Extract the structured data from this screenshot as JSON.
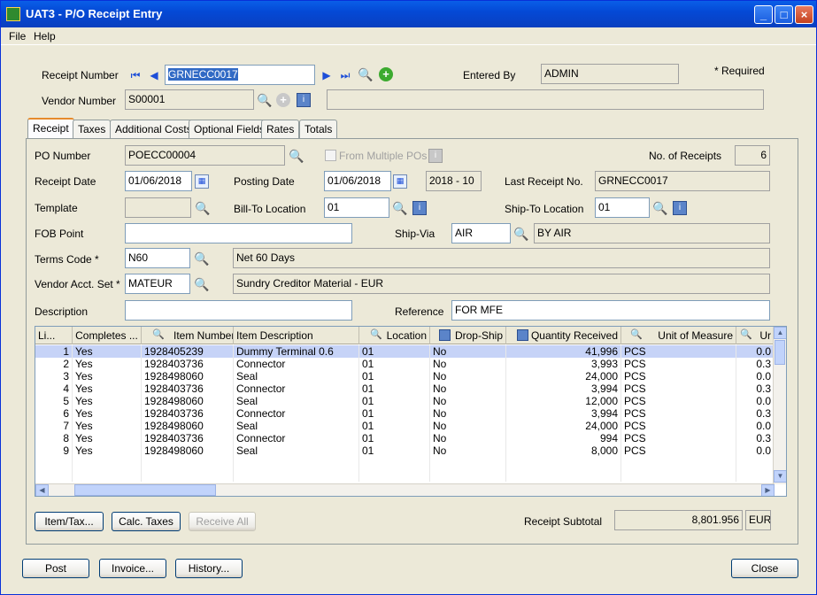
{
  "window": {
    "title": "UAT3 - P/O Receipt Entry"
  },
  "menu": {
    "file": "File",
    "help": "Help"
  },
  "header": {
    "receipt_number_label": "Receipt Number",
    "receipt_number": "GRNECC0017",
    "entered_by_label": "Entered By",
    "entered_by": "ADMIN",
    "required_note": "*  Required",
    "vendor_number_label": "Vendor Number",
    "vendor_number": "S00001",
    "vendor_name": ""
  },
  "tabs": [
    "Receipt",
    "Taxes",
    "Additional Costs",
    "Optional Fields",
    "Rates",
    "Totals"
  ],
  "form": {
    "po_number_label": "PO Number",
    "po_number": "POECC00004",
    "from_multiple_pos": "From Multiple POs",
    "no_of_receipts_label": "No. of Receipts",
    "no_of_receipts": "6",
    "receipt_date_label": "Receipt Date",
    "receipt_date": "01/06/2018",
    "posting_date_label": "Posting Date",
    "posting_date": "01/06/2018",
    "period": "2018 - 10",
    "last_receipt_label": "Last Receipt No.",
    "last_receipt": "GRNECC0017",
    "template_label": "Template",
    "template": "",
    "bill_to_label": "Bill-To Location",
    "bill_to": "01",
    "ship_to_label": "Ship-To Location",
    "ship_to": "01",
    "fob_label": "FOB Point",
    "fob": "",
    "ship_via_label": "Ship-Via",
    "ship_via": "AIR",
    "ship_via_desc": "BY AIR",
    "terms_label": "Terms Code *",
    "terms": "N60",
    "terms_desc": "Net 60 Days",
    "vendor_acct_label": "Vendor Acct. Set *",
    "vendor_acct": "MATEUR",
    "vendor_acct_desc": "Sundry Creditor Material - EUR",
    "description_label": "Description",
    "description": "",
    "reference_label": "Reference",
    "reference": "FOR MFE"
  },
  "grid": {
    "columns": [
      "Li...",
      "Completes ...",
      "Item Number",
      "Item Description",
      "Location",
      "Drop-Ship",
      "Quantity Received",
      "Unit of Measure",
      "Ur"
    ],
    "rows": [
      [
        "1",
        "Yes",
        "1928405239",
        "Dummy Terminal 0.6",
        "01",
        "No",
        "41,996",
        "PCS",
        "0.0"
      ],
      [
        "2",
        "Yes",
        "1928403736",
        "Connector",
        "01",
        "No",
        "3,993",
        "PCS",
        "0.3"
      ],
      [
        "3",
        "Yes",
        "1928498060",
        "Seal",
        "01",
        "No",
        "24,000",
        "PCS",
        "0.0"
      ],
      [
        "4",
        "Yes",
        "1928403736",
        "Connector",
        "01",
        "No",
        "3,994",
        "PCS",
        "0.3"
      ],
      [
        "5",
        "Yes",
        "1928498060",
        "Seal",
        "01",
        "No",
        "12,000",
        "PCS",
        "0.0"
      ],
      [
        "6",
        "Yes",
        "1928403736",
        "Connector",
        "01",
        "No",
        "3,994",
        "PCS",
        "0.3"
      ],
      [
        "7",
        "Yes",
        "1928498060",
        "Seal",
        "01",
        "No",
        "24,000",
        "PCS",
        "0.0"
      ],
      [
        "8",
        "Yes",
        "1928403736",
        "Connector",
        "01",
        "No",
        "994",
        "PCS",
        "0.3"
      ],
      [
        "9",
        "Yes",
        "1928498060",
        "Seal",
        "01",
        "No",
        "8,000",
        "PCS",
        "0.0"
      ]
    ]
  },
  "buttons": {
    "item_tax": "Item/Tax...",
    "calc_taxes": "Calc. Taxes",
    "receive_all": "Receive All",
    "post": "Post",
    "invoice": "Invoice...",
    "history": "History...",
    "close": "Close"
  },
  "subtotal": {
    "label": "Receipt Subtotal",
    "value": "8,801.956",
    "currency": "EUR"
  }
}
